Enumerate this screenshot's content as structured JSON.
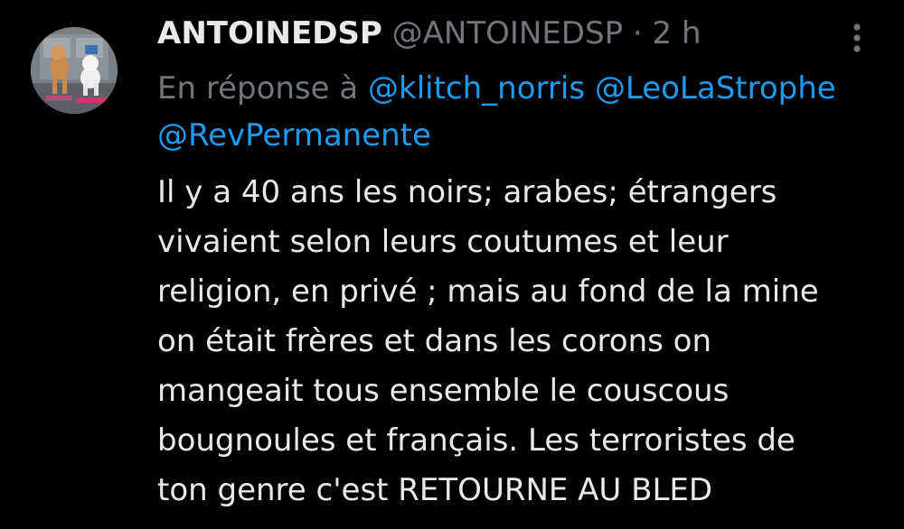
{
  "tweet": {
    "display_name": "ANTOINEDSP",
    "handle": "@ANTOINEDSP",
    "separator": "·",
    "time": "2 h",
    "reply_prefix": "En réponse à",
    "mentions": [
      "@klitch_norris",
      "@LeoLaStrophe",
      "@RevPermanente"
    ],
    "body_lines": [
      "Il y a 40 ans les noirs; arabes; étrangers",
      "vivaient selon leurs coutumes et leur",
      "religion, en privé ; mais au fond de la mine",
      "on était frères et dans les corons on",
      "mangeait tous ensemble le couscous",
      "bougnoules et français. Les terroristes de",
      "ton genre c'est RETOURNE AU BLED"
    ]
  },
  "icons": {
    "more": "more-vertical-icon",
    "avatar": "avatar-dogs-photo"
  },
  "colors": {
    "background": "#000000",
    "text": "#e7e9ea",
    "muted": "#71767b",
    "link": "#1d9bf0"
  }
}
